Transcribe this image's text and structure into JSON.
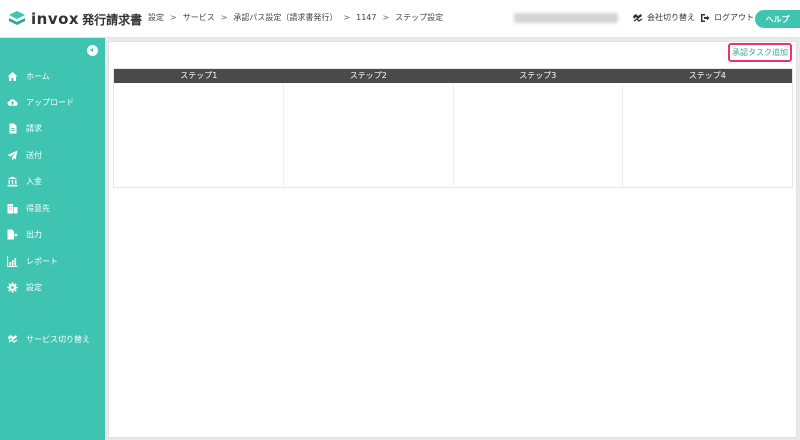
{
  "app": {
    "logo_text": "invox",
    "logo_sub": "発行請求書"
  },
  "breadcrumb": [
    "設定",
    "サービス",
    "承認パス設定（請求書発行）",
    "1147",
    "ステップ設定"
  ],
  "breadcrumb_sep": ">",
  "header": {
    "switch_label": "会社切り替え",
    "logout_label": "ログアウト",
    "help_label": "ヘルプ"
  },
  "sidebar": {
    "items": [
      {
        "label": "ホーム",
        "icon": "home-icon"
      },
      {
        "label": "アップロード",
        "icon": "cloud-upload-icon"
      },
      {
        "label": "請求",
        "icon": "document-icon"
      },
      {
        "label": "送付",
        "icon": "paper-plane-icon"
      },
      {
        "label": "入金",
        "icon": "bank-icon"
      },
      {
        "label": "得意先",
        "icon": "building-icon"
      },
      {
        "label": "出力",
        "icon": "file-export-icon"
      },
      {
        "label": "レポート",
        "icon": "chart-icon"
      },
      {
        "label": "設定",
        "icon": "gear-icon"
      },
      {
        "label": "サービス切り替え",
        "icon": "switch-icon"
      }
    ]
  },
  "main": {
    "add_task_label": "承認タスク追加",
    "steps": [
      "ステップ1",
      "ステップ2",
      "ステップ3",
      "ステップ4"
    ]
  },
  "colors": {
    "accent": "#3ec4b1",
    "header_bar": "#4a4a4a",
    "highlight": "#e8336d"
  }
}
